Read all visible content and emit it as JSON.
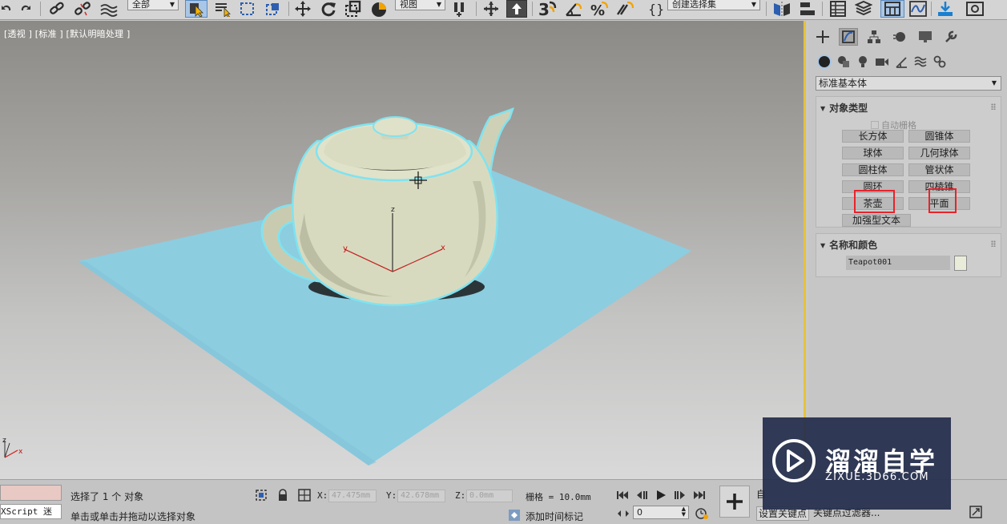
{
  "toolbar": {
    "selection_filter": "全部",
    "ref_coord_system": "视图",
    "named_selection_set": "创建选择集",
    "icons": [
      "undo-icon",
      "redo-icon",
      "link-icon",
      "unlink-icon",
      "bind-space-warp-icon",
      "select-object-icon",
      "select-by-name-icon",
      "region-select-icon",
      "window-crossing-icon",
      "move-icon",
      "rotate-icon",
      "scale-icon",
      "placement-icon",
      "use-pivot-center-icon",
      "select-manipulate-icon",
      "keyboard-shortcut-icon",
      "snap-3d-icon",
      "angle-snap-icon",
      "percent-snap-icon",
      "spinner-snap-icon",
      "edit-named-selection-icon",
      "mirror-icon",
      "align-icon",
      "scene-explorer-icon",
      "layer-explorer-icon",
      "ribbon-icon",
      "curve-editor-icon",
      "render-setup-icon",
      "rendered-frame-icon"
    ]
  },
  "viewport": {
    "label": "[透视 ] [标准 ] [默认明暗处理 ]",
    "axis_labels": {
      "x": "x",
      "y": "y",
      "z": "z"
    },
    "colors": {
      "plane": "#8ccde0",
      "selection_outline": "#7fe3f0",
      "teapot": "#d8dac0",
      "active_border": "#e6c23c"
    }
  },
  "panel": {
    "tabs": [
      "create-tab",
      "modify-tab",
      "hierarchy-tab",
      "motion-tab",
      "display-tab",
      "utilities-tab"
    ],
    "categories": [
      "geometry-icon",
      "shapes-icon",
      "lights-icon",
      "cameras-icon",
      "helpers-icon",
      "space-warps-icon",
      "systems-icon"
    ],
    "dropdown": "标准基本体",
    "object_type": {
      "title": "对象类型",
      "autogrid": "自动栅格",
      "buttons": [
        "长方体",
        "圆锥体",
        "球体",
        "几何球体",
        "圆柱体",
        "管状体",
        "圆环",
        "四棱锥",
        "茶壶",
        "平面",
        "加强型文本"
      ]
    },
    "name_color": {
      "title": "名称和颜色",
      "name": "Teapot001",
      "swatch": "#e9ecd9"
    }
  },
  "status": {
    "maxscript": "XScript 迷",
    "selection": "选择了 1 个 对象",
    "prompt": "单击或单击并拖动以选择对象",
    "x_label": "X:",
    "x_value": "47.475mm",
    "y_label": "Y:",
    "y_value": "42.678mm",
    "z_label": "Z:",
    "z_value": "0.0mm",
    "grid": "栅格 = 10.0mm",
    "add_time_tag": "添加时间标记",
    "frame": "0",
    "auto_key": "自",
    "set_key": "设置关键点",
    "key_filters": "关键点过滤器..."
  },
  "watermark": {
    "title": "溜溜自学",
    "url": "ZIXUE.3D66.COM"
  }
}
